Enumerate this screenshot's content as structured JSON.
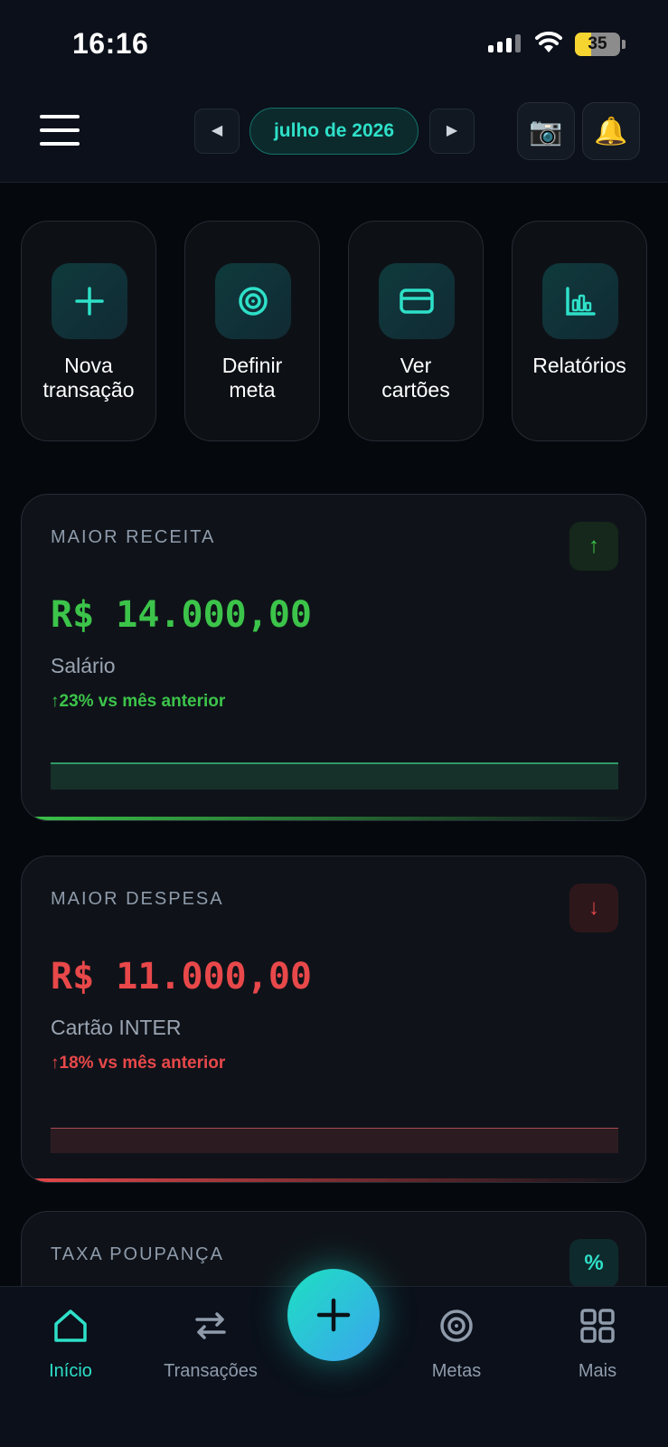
{
  "status_bar": {
    "time": "16:16",
    "battery_level": "35"
  },
  "header": {
    "month": "julho de 2026",
    "prev_symbol": "◀",
    "next_symbol": "▶",
    "camera_symbol": "📷",
    "bell_symbol": "🔔"
  },
  "quick_actions": [
    {
      "label": "Nova\ntransação",
      "icon": "plus-icon"
    },
    {
      "label": "Definir\nmeta",
      "icon": "target-icon"
    },
    {
      "label": "Ver\ncartões",
      "icon": "credit-card-icon"
    },
    {
      "label": "Relatórios",
      "icon": "bar-chart-icon"
    }
  ],
  "cards": {
    "income": {
      "label": "MAIOR RECEITA",
      "arrow": "↑",
      "value": "R$ 14.000,00",
      "source": "Salário",
      "change": "↑23% vs mês anterior"
    },
    "expense": {
      "label": "MAIOR DESPESA",
      "arrow": "↓",
      "value": "R$ 11.000,00",
      "source": "Cartão INTER",
      "change": "↑18% vs mês anterior"
    },
    "savings": {
      "label": "TAXA POUPANÇA",
      "symbol": "%"
    }
  },
  "bottom_nav": {
    "items": [
      {
        "label": "Início",
        "active": true,
        "icon": "home-icon"
      },
      {
        "label": "Transações",
        "active": false,
        "icon": "swap-icon"
      },
      {
        "label": "Metas",
        "active": false,
        "icon": "target-icon"
      },
      {
        "label": "Mais",
        "active": false,
        "icon": "grid-icon"
      }
    ],
    "fab_icon": "plus-icon"
  },
  "colors": {
    "accent": "#2ee0c8",
    "income": "#3cc44a",
    "expense": "#e8484a",
    "background": "#05080d"
  }
}
